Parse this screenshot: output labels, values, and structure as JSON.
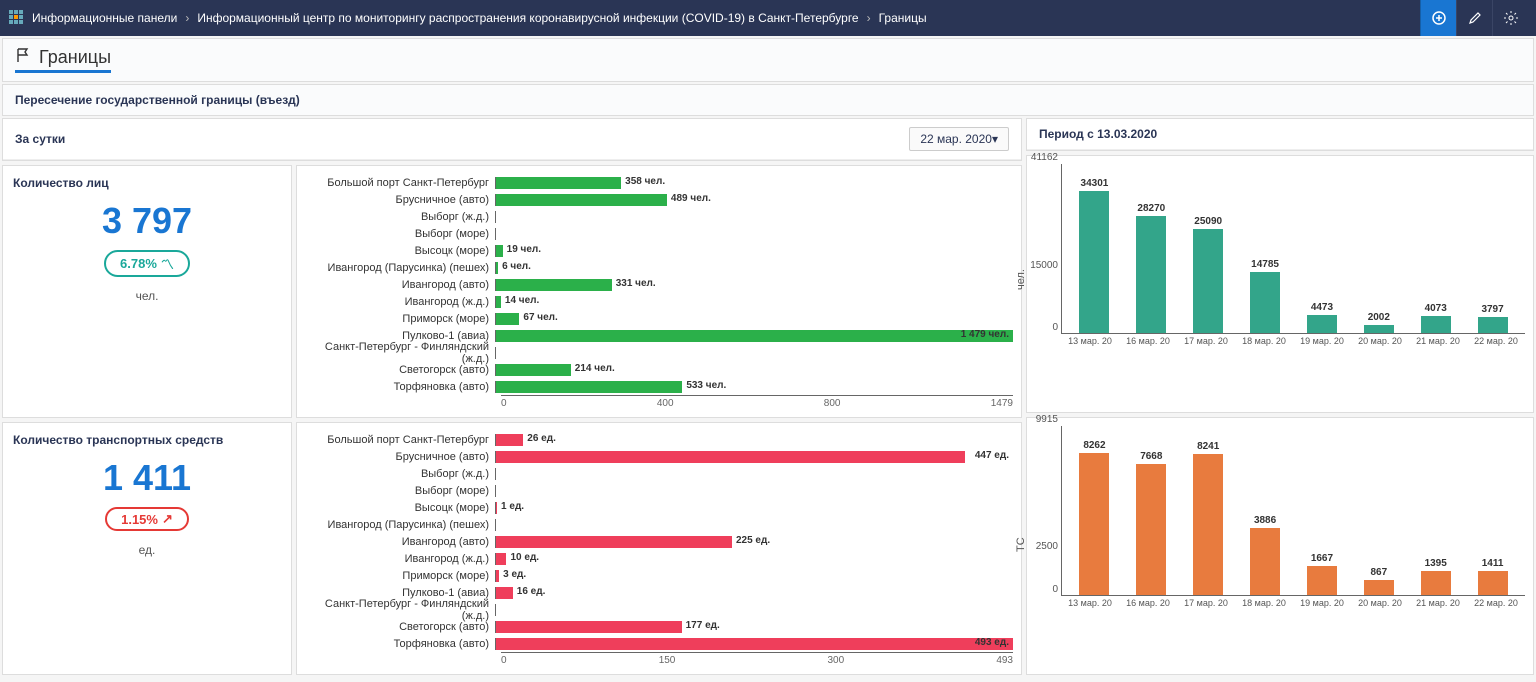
{
  "breadcrumbs": [
    "Информационные панели",
    "Информационный центр по мониторингу распространения коронавирусной инфекции (COVID-19) в Санкт-Петербурге",
    "Границы"
  ],
  "page_title": "Границы",
  "section_title": "Пересечение государственной границы (въезд)",
  "daily_label": "За сутки",
  "date_selected": "22 мар. 2020",
  "period_label": "Период с 13.03.2020",
  "kpi_persons": {
    "title": "Количество лиц",
    "value": "3 797",
    "delta": "6.78%",
    "delta_dir": "down",
    "unit": "чел."
  },
  "kpi_vehicles": {
    "title": "Количество транспортных средств",
    "value": "1 411",
    "delta": "1.15%",
    "delta_dir": "up",
    "unit": "ед."
  },
  "chart_data": [
    {
      "id": "hbar_persons",
      "type": "bar",
      "orientation": "horizontal",
      "color": "#2bb04a",
      "xlim": [
        0,
        1479
      ],
      "xticks": [
        0,
        400,
        800,
        1479
      ],
      "unit_suffix": " чел.",
      "categories": [
        "Большой порт Санкт-Петербург",
        "Брусничное (авто)",
        "Выборг (ж.д.)",
        "Выборг (море)",
        "Высоцк (море)",
        "Ивангород (Парусинка) (пешех)",
        "Ивангород (авто)",
        "Ивангород (ж.д.)",
        "Приморск (море)",
        "Пулково-1 (авиа)",
        "Санкт-Петербург - Финляндский (ж.д.)",
        "Светогорск (авто)",
        "Торфяновка (авто)"
      ],
      "values": [
        358,
        489,
        0,
        0,
        19,
        6,
        331,
        14,
        67,
        1479,
        0,
        214,
        533
      ],
      "labels": [
        "358",
        "489",
        "",
        "",
        "19",
        "6",
        "331",
        "14",
        "67",
        "1 479",
        "",
        "214",
        "533"
      ]
    },
    {
      "id": "hbar_vehicles",
      "type": "bar",
      "orientation": "horizontal",
      "color": "#ef3e5b",
      "xlim": [
        0,
        493
      ],
      "xticks": [
        0,
        150,
        300,
        493
      ],
      "unit_suffix": " ед.",
      "categories": [
        "Большой порт Санкт-Петербург",
        "Брусничное (авто)",
        "Выборг (ж.д.)",
        "Выборг (море)",
        "Высоцк (море)",
        "Ивангород (Парусинка) (пешех)",
        "Ивангород (авто)",
        "Ивангород (ж.д.)",
        "Приморск (море)",
        "Пулково-1 (авиа)",
        "Санкт-Петербург - Финляндский (ж.д.)",
        "Светогорск (авто)",
        "Торфяновка (авто)"
      ],
      "values": [
        26,
        447,
        0,
        0,
        1,
        0,
        225,
        10,
        3,
        16,
        0,
        177,
        493
      ],
      "labels": [
        "26",
        "447",
        "",
        "",
        "1",
        "",
        "225",
        "10",
        "3",
        "16",
        "",
        "177",
        "493"
      ]
    },
    {
      "id": "vbar_persons",
      "type": "bar",
      "orientation": "vertical",
      "color": "#33a58a",
      "ylabel": "чел.",
      "ylim": [
        0,
        41162
      ],
      "yticks": [
        0,
        15000,
        41162
      ],
      "categories": [
        "13 мар. 20",
        "16 мар. 20",
        "17 мар. 20",
        "18 мар. 20",
        "19 мар. 20",
        "20 мар. 20",
        "21 мар. 20",
        "22 мар. 20"
      ],
      "values": [
        34301,
        28270,
        25090,
        14785,
        4473,
        2002,
        4073,
        3797
      ]
    },
    {
      "id": "vbar_vehicles",
      "type": "bar",
      "orientation": "vertical",
      "color": "#e87b3e",
      "ylabel": "ТС",
      "ylim": [
        0,
        9915
      ],
      "yticks": [
        0,
        2500,
        9915
      ],
      "categories": [
        "13 мар. 20",
        "16 мар. 20",
        "17 мар. 20",
        "18 мар. 20",
        "19 мар. 20",
        "20 мар. 20",
        "21 мар. 20",
        "22 мар. 20"
      ],
      "values": [
        8262,
        7668,
        8241,
        3886,
        1667,
        867,
        1395,
        1411
      ]
    }
  ]
}
